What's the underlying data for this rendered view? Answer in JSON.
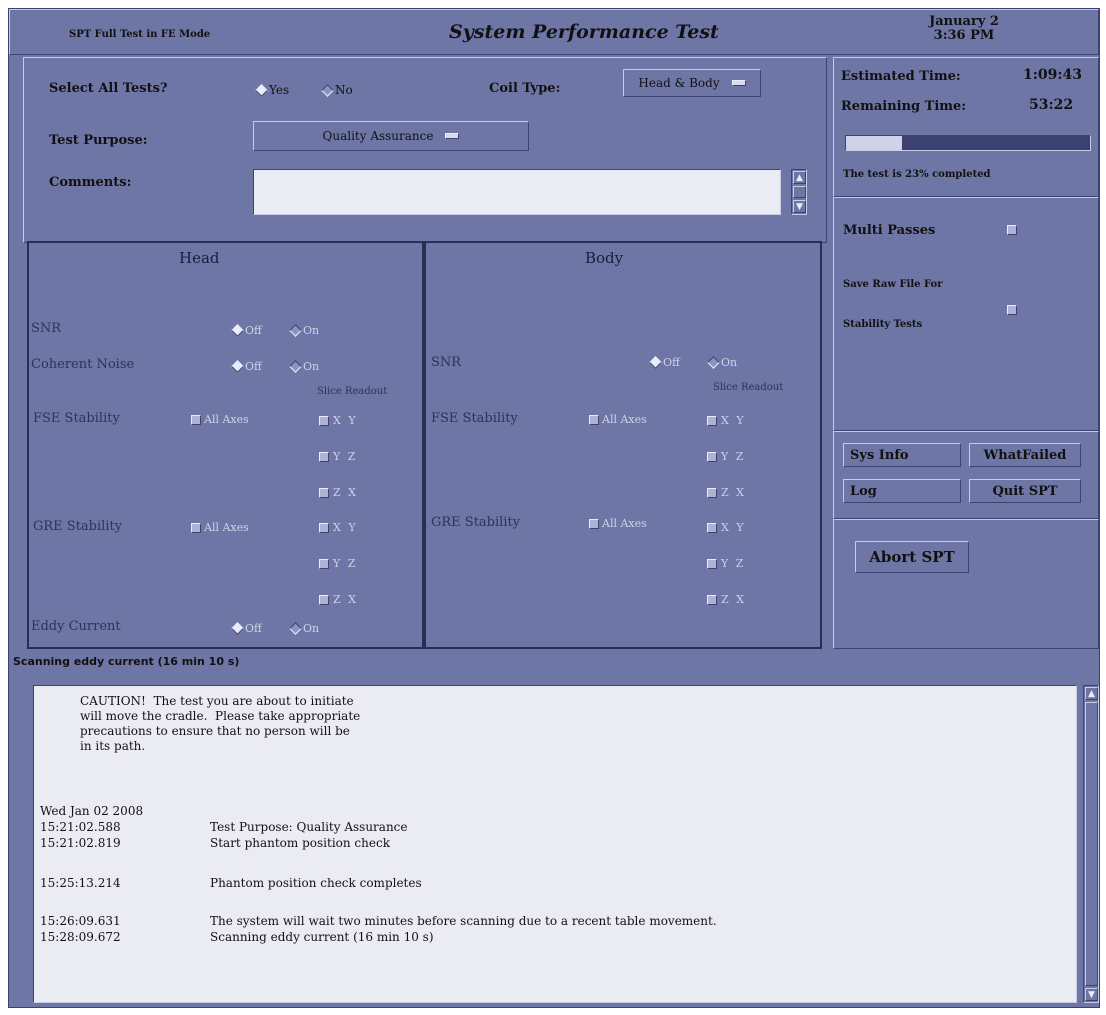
{
  "header": {
    "mode_label": "SPT Full Test in FE Mode",
    "title": "System Performance Test",
    "date": "January 2",
    "time": "3:36 PM"
  },
  "controls": {
    "select_all_label": "Select All Tests?",
    "select_all_options": [
      {
        "label": "Yes",
        "selected": true
      },
      {
        "label": "No",
        "selected": false
      }
    ],
    "coil_type_label": "Coil Type:",
    "coil_type_value": "Head & Body",
    "test_purpose_label": "Test Purpose:",
    "test_purpose_value": "Quality Assurance",
    "comments_label": "Comments:",
    "comments_value": ""
  },
  "head": {
    "title": "Head",
    "snr_label": "SNR",
    "coherent_noise_label": "Coherent Noise",
    "fse_label": "FSE Stability",
    "gre_label": "GRE Stability",
    "eddy_label": "Eddy Current",
    "off_label": "Off",
    "on_label": "On",
    "all_axes_label": "All Axes",
    "slice_readout_label": "Slice Readout"
  },
  "body": {
    "title": "Body",
    "snr_label": "SNR",
    "fse_label": "FSE Stability",
    "gre_label": "GRE Stability",
    "off_label": "Off",
    "on_label": "On",
    "all_axes_label": "All Axes",
    "slice_readout_label": "Slice Readout"
  },
  "axes": [
    "X  Y",
    "Y  Z",
    "Z  X"
  ],
  "status": {
    "estimated_label": "Estimated Time:",
    "estimated_value": "1:09:43",
    "remaining_label": "Remaining Time:",
    "remaining_value": "53:22",
    "progress_text": "The test is  23% completed",
    "progress_fraction": 0.23
  },
  "options": {
    "multi_passes_label": "Multi Passes",
    "save_raw_line1": "Save Raw File For",
    "save_raw_line2": "Stability Tests"
  },
  "buttons": {
    "sys_info": "Sys Info",
    "what_failed": "WhatFailed",
    "log": "Log",
    "quit": "Quit SPT",
    "abort": "Abort SPT"
  },
  "scan_status": "Scanning eddy current (16 min 10 s)",
  "log": {
    "caution": "CAUTION!  The test you are about to initiate\nwill move the cradle.  Please take appropriate\nprecautions to ensure that no person will be\nin its path.",
    "date_line": "Wed Jan 02 2008",
    "entries": [
      {
        "ts": "15:21:02.588",
        "msg": "Test Purpose: Quality Assurance"
      },
      {
        "ts": "15:21:02.819",
        "msg": "Start phantom position check"
      },
      {
        "ts": "15:25:13.214",
        "msg": "Phantom position check completes"
      },
      {
        "ts": "15:26:09.631",
        "msg": "The system will wait two minutes before scanning due to a recent table movement."
      },
      {
        "ts": "15:28:09.672",
        "msg": "Scanning eddy current (16 min 10 s)"
      }
    ]
  }
}
